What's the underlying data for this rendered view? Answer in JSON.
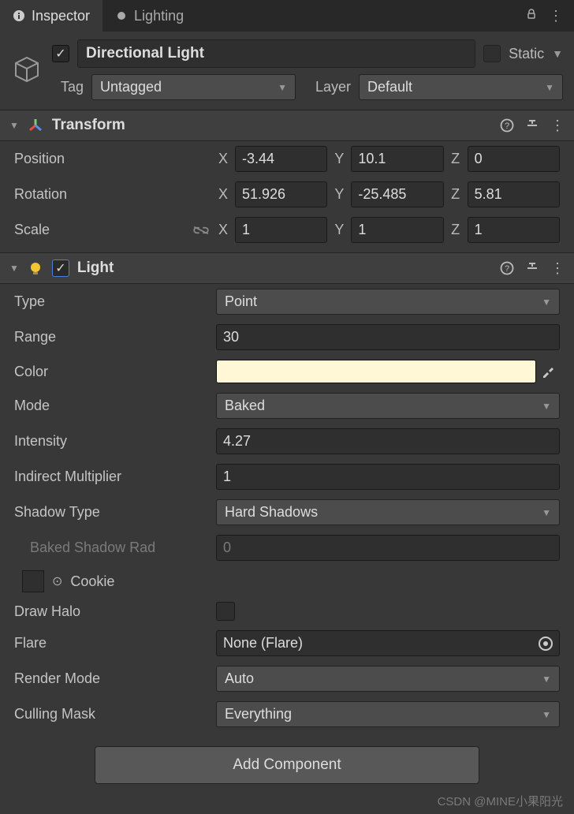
{
  "tabs": {
    "inspector": "Inspector",
    "lighting": "Lighting"
  },
  "header": {
    "enabled": true,
    "name": "Directional Light",
    "static_label": "Static",
    "tag_label": "Tag",
    "tag_value": "Untagged",
    "layer_label": "Layer",
    "layer_value": "Default"
  },
  "transform": {
    "title": "Transform",
    "position_label": "Position",
    "rotation_label": "Rotation",
    "scale_label": "Scale",
    "position": {
      "x": "-3.44",
      "y": "10.1",
      "z": "0"
    },
    "rotation": {
      "x": "51.926",
      "y": "-25.485",
      "z": "5.81"
    },
    "scale": {
      "x": "1",
      "y": "1",
      "z": "1"
    },
    "ax": {
      "x": "X",
      "y": "Y",
      "z": "Z"
    }
  },
  "light": {
    "title": "Light",
    "type_label": "Type",
    "type_value": "Point",
    "range_label": "Range",
    "range_value": "30",
    "color_label": "Color",
    "color_value": "#FFF7D6",
    "mode_label": "Mode",
    "mode_value": "Baked",
    "intensity_label": "Intensity",
    "intensity_value": "4.27",
    "indirect_label": "Indirect Multiplier",
    "indirect_value": "1",
    "shadow_type_label": "Shadow Type",
    "shadow_type_value": "Hard Shadows",
    "baked_shadow_label": "Baked Shadow Rad",
    "baked_shadow_value": "0",
    "cookie_label": "Cookie",
    "draw_halo_label": "Draw Halo",
    "flare_label": "Flare",
    "flare_value": "None (Flare)",
    "render_mode_label": "Render Mode",
    "render_mode_value": "Auto",
    "culling_mask_label": "Culling Mask",
    "culling_mask_value": "Everything"
  },
  "add_component": "Add Component",
  "watermark": "CSDN @MINE小果阳光"
}
